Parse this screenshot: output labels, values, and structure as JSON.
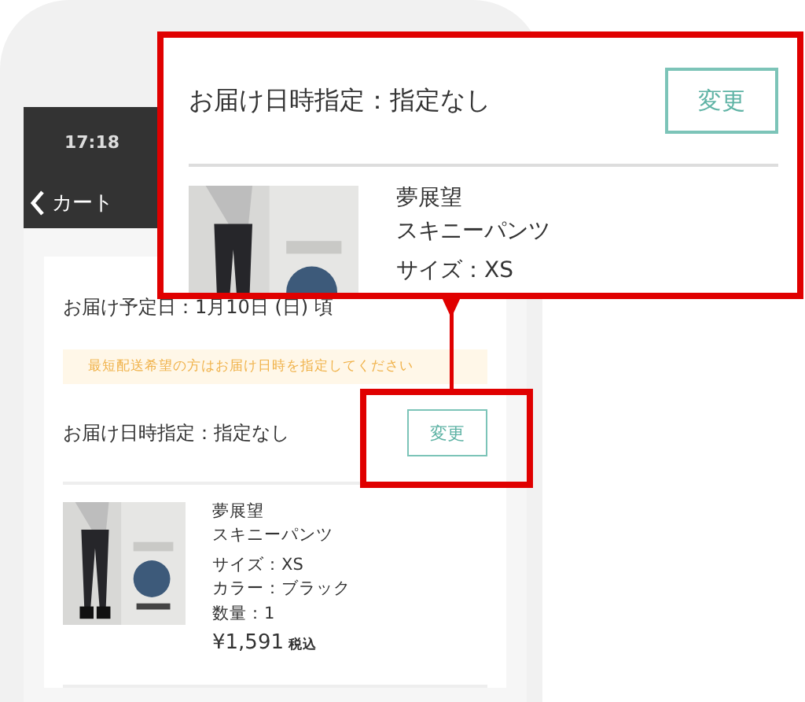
{
  "status_bar": {
    "time": "17:18"
  },
  "nav": {
    "back_label": "カート"
  },
  "delivery": {
    "estimate": "お届け予定日：1月10日 (日) 頃",
    "notice": "最短配送希望の方はお届け日時を指定してください",
    "spec_label": "お届け日時指定：指定なし",
    "change_button": "変更"
  },
  "item": {
    "brand": "夢展望",
    "name": "スキニーパンツ",
    "size": "サイズ：XS",
    "color_label": "カラー：ブラック",
    "quantity": "数量：1",
    "price": "¥1,591",
    "tax_note": "税込"
  },
  "callout": {
    "spec_label": "お届け日時指定：指定なし",
    "change_button": "変更",
    "brand": "夢展望",
    "name": "スキニーパンツ",
    "size": "サイズ：XS"
  }
}
